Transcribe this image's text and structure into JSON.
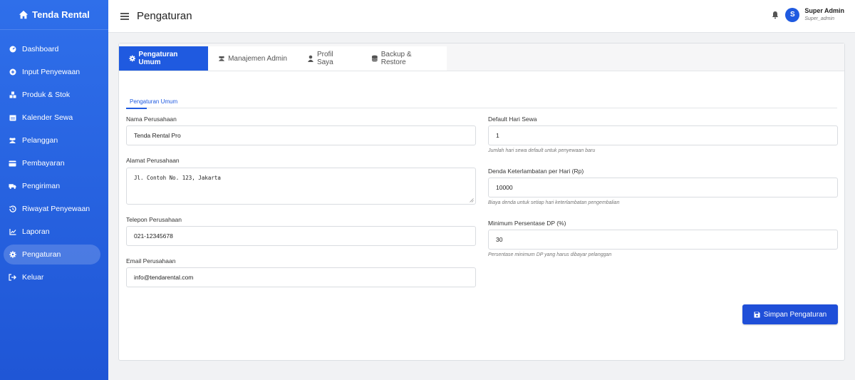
{
  "app": {
    "brand": "Tenda Rental"
  },
  "sidebar": {
    "items": [
      {
        "label": "Dashboard",
        "icon": "gauge-icon"
      },
      {
        "label": "Input Penyewaan",
        "icon": "plus-circle-icon"
      },
      {
        "label": "Produk & Stok",
        "icon": "boxes-icon"
      },
      {
        "label": "Kalender Sewa",
        "icon": "calendar-icon"
      },
      {
        "label": "Pelanggan",
        "icon": "users-icon"
      },
      {
        "label": "Pembayaran",
        "icon": "credit-card-icon"
      },
      {
        "label": "Pengiriman",
        "icon": "truck-icon"
      },
      {
        "label": "Riwayat Penyewaan",
        "icon": "history-icon"
      },
      {
        "label": "Laporan",
        "icon": "chart-icon"
      },
      {
        "label": "Pengaturan",
        "icon": "gear-icon",
        "active": true
      },
      {
        "label": "Keluar",
        "icon": "sign-out-icon"
      }
    ]
  },
  "header": {
    "title": "Pengaturan",
    "user_name": "Super Admin",
    "user_role": "Super_admin",
    "avatar_letter": "S"
  },
  "tabs": [
    {
      "label": "Pengaturan Umum",
      "active": true
    },
    {
      "label": "Manajemen Admin"
    },
    {
      "label": "Profil Saya"
    },
    {
      "label": "Backup & Restore"
    }
  ],
  "section": {
    "title": "Pengaturan Umum"
  },
  "form": {
    "company_name": {
      "label": "Nama Perusahaan",
      "value": "Tenda Rental Pro"
    },
    "company_address": {
      "label": "Alamat Perusahaan",
      "value": "Jl. Contoh No. 123, Jakarta"
    },
    "company_phone": {
      "label": "Telepon Perusahaan",
      "value": "021-12345678"
    },
    "company_email": {
      "label": "Email Perusahaan",
      "value": "info@tendarental.com"
    },
    "default_days": {
      "label": "Default Hari Sewa",
      "value": "1",
      "help": "Jumlah hari sewa default untuk penyewaan baru"
    },
    "late_fee": {
      "label": "Denda Keterlambatan per Hari (Rp)",
      "value": "10000",
      "help": "Biaya denda untuk setiap hari keterlambatan pengembalian"
    },
    "min_dp": {
      "label": "Minimum Persentase DP (%)",
      "value": "30",
      "help": "Persentase minimum DP yang harus dibayar pelanggan"
    }
  },
  "actions": {
    "save_label": "Simpan Pengaturan"
  },
  "colors": {
    "primary": "#1f5ae0",
    "sidebar": "#2563eb"
  }
}
